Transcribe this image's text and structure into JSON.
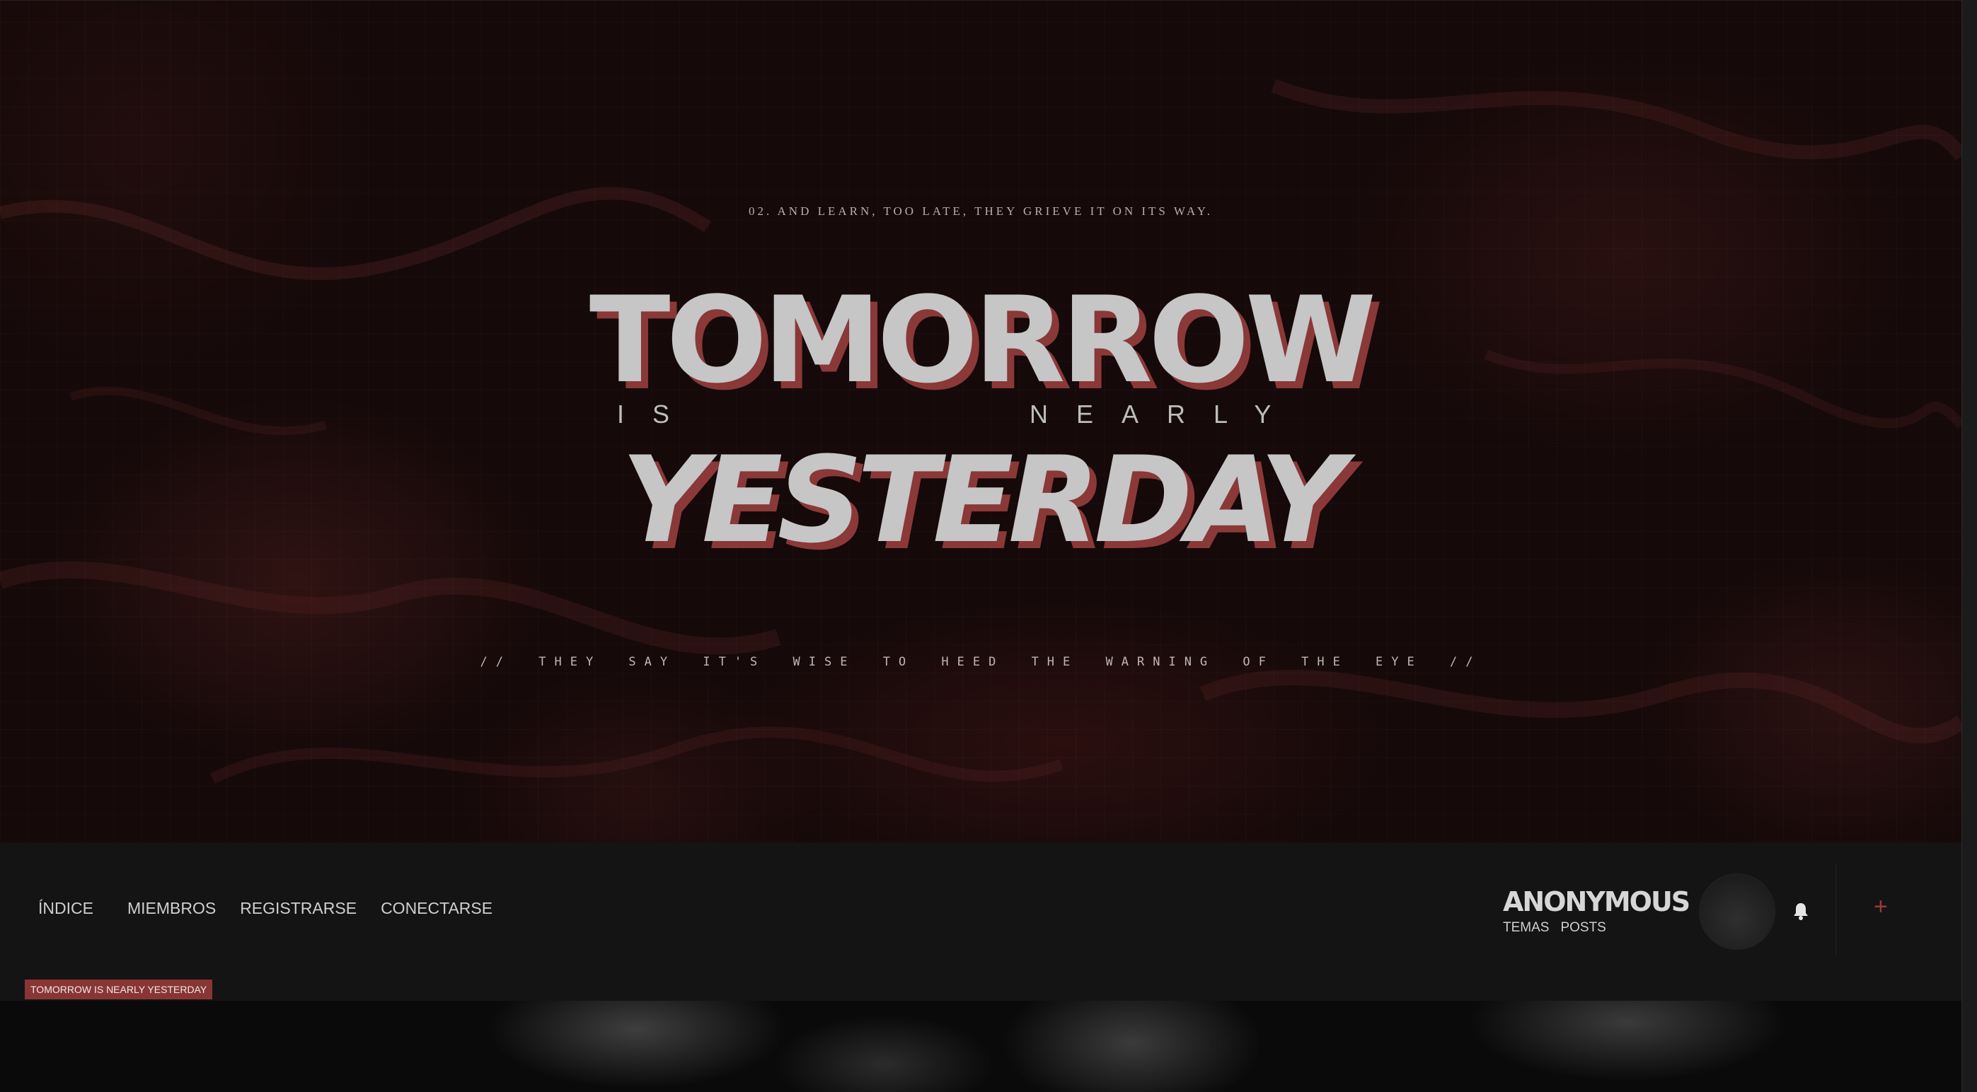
{
  "hero": {
    "eyebrow": "02. AND LEARN, TOO LATE, THEY GRIEVE IT ON ITS WAY.",
    "title_top": "TOMORROW",
    "title_mid_left": "IS",
    "title_mid_right": "NEARLY",
    "title_bottom": "YESTERDAY",
    "tagline": "// THEY SAY IT'S WISE TO HEED THE WARNING OF THE EYE //"
  },
  "nav": {
    "links": [
      "ÍNDICE",
      "MIEMBROS",
      "REGISTRARSE",
      "CONECTARSE"
    ]
  },
  "user": {
    "name": "ANONYMOUS",
    "temas_label": "TEMAS",
    "posts_label": "POSTS",
    "avatar_icon": "avatar-placeholder",
    "bell_icon": "bell-icon",
    "plus_icon": "plus-icon"
  },
  "breadcrumb": {
    "label": "TOMORROW IS NEARLY YESTERDAY"
  },
  "colors": {
    "accent": "#8a3535",
    "title_shadow": "#8a3838",
    "hero_bg": "#150909",
    "nav_bg": "#141414"
  }
}
